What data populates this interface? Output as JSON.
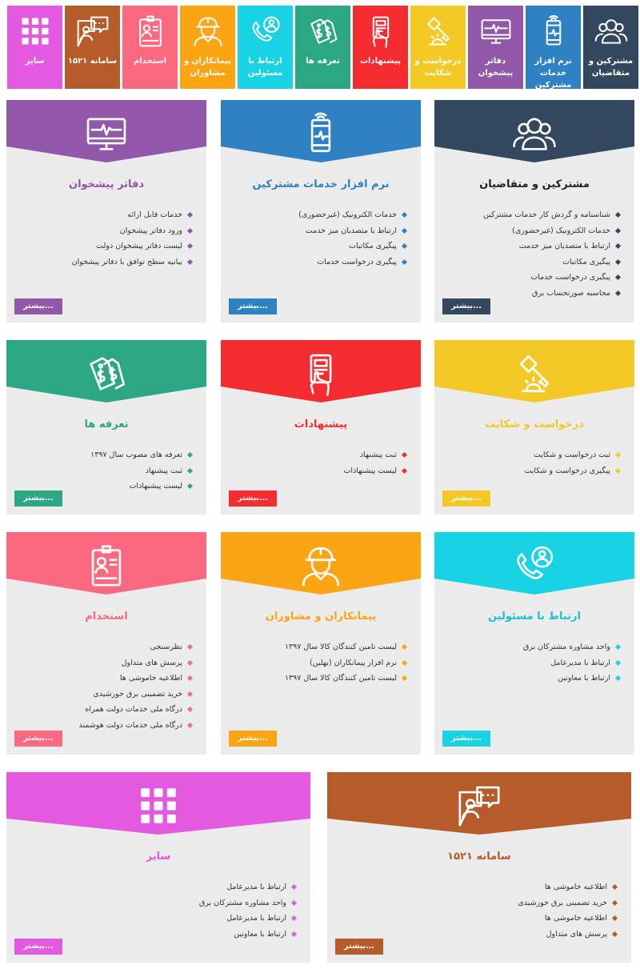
{
  "colors": {
    "navy": "#33485f",
    "blue": "#2e81c3",
    "purple": "#9157a8",
    "yellow": "#f4c825",
    "red": "#f42c2f",
    "green": "#2ba784",
    "cyan": "#18d3e3",
    "orange": "#fba414",
    "pink": "#fb6980",
    "magenta": "#e359e0",
    "brown": "#b65c2b"
  },
  "topnav": [
    {
      "label": "مشترکین و متقاضیان",
      "icon": "users-icon",
      "color": "#33485f"
    },
    {
      "label": "نرم افزار خدمات مشترکین",
      "icon": "mobile-pulse-icon",
      "color": "#2e81c3"
    },
    {
      "label": "دفاتر پیشخوان",
      "icon": "monitor-pulse-icon",
      "color": "#9157a8"
    },
    {
      "label": "درخواست و شکایت",
      "icon": "gavel-icon",
      "color": "#f4c825"
    },
    {
      "label": "پیشنهادات",
      "icon": "hand-phone-icon",
      "color": "#f42c2f"
    },
    {
      "label": "تعرفه ها",
      "icon": "price-tag-icon",
      "color": "#2ba784"
    },
    {
      "label": "ارتباط با مسئولین",
      "icon": "phone-user-icon",
      "color": "#18d3e3"
    },
    {
      "label": "پیمانکاران و مشاوران",
      "icon": "worker-icon",
      "color": "#fba414"
    },
    {
      "label": "استخدام",
      "icon": "id-card-icon",
      "color": "#fb6980"
    },
    {
      "label": "سامانه ۱۵۲۱",
      "icon": "chat-user-icon",
      "color": "#b65c2b"
    },
    {
      "label": "سایر",
      "icon": "grid-icon",
      "color": "#e359e0"
    }
  ],
  "more_label": "بیشتر...",
  "cards": [
    {
      "title": "مشترکین و متقاضیان",
      "icon": "users-icon",
      "color": "#33485f",
      "title_color": "#222222",
      "items": [
        "شناسنامه و گردش کار خدمات مشترکین",
        "خدمات الکترونیک (غیرحضوری)",
        "ارتباط با متصدیان میز خدمت",
        "پیگیری مکاتبات",
        "پیگیری درخواست خدمات",
        "محاسبه صورتحساب برق"
      ]
    },
    {
      "title": "نرم افزار خدمات مشترکین",
      "icon": "mobile-pulse-icon",
      "color": "#2e81c3",
      "title_color": "#2e81c3",
      "items": [
        "خدمات الکترونیک (غیرحضوری)",
        "ارتباط با متصدیان میز خدمت",
        "پیگیری مکاتبات",
        "پیگیری درخواست خدمات"
      ]
    },
    {
      "title": "دفاتر پیشخوان",
      "icon": "monitor-pulse-icon",
      "color": "#9157a8",
      "title_color": "#9157a8",
      "items": [
        "خدمات قابل ارائه",
        "ورود دفاتر پیشخوان",
        "لیست دفاتر پیشخوان دولت",
        "بیانیه سطح توافق با دفاتر پیشخوان"
      ]
    },
    {
      "title": "درخواست و شکایت",
      "icon": "gavel-icon",
      "color": "#f4c825",
      "title_color": "#f4c825",
      "items": [
        "ثبت درخواست و شکایت",
        "پیگیری درخواست و شکایت"
      ]
    },
    {
      "title": "پیشنهادات",
      "icon": "hand-phone-icon",
      "color": "#f42c2f",
      "title_color": "#f42c2f",
      "items": [
        "ثبت پیشنهاد",
        "لیست پیشنهادات"
      ]
    },
    {
      "title": "تعرفه ها",
      "icon": "price-tag-icon",
      "color": "#2ba784",
      "title_color": "#2ba784",
      "items": [
        "تعرفه های مصوب سال ۱۳۹۷",
        "ثبت پیشنهاد",
        "لیست پیشنهادات"
      ]
    },
    {
      "title": "ارتباط با مسئولین",
      "icon": "phone-user-icon",
      "color": "#18d3e3",
      "title_color": "#18c3d3",
      "items": [
        "واحد مشاوره مشترکان برق",
        "ارتباط با مدیرعامل",
        "ارتباط با معاونین"
      ]
    },
    {
      "title": "پیمانکاران و مشاوران",
      "icon": "worker-icon",
      "color": "#fba414",
      "title_color": "#fba414",
      "items": [
        "لیست تامین کنندگان کالا سال ۱۳۹۷",
        "نرم افزار پیمانکاران (بهلین)",
        "لیست تامین کنندگان کالا سال ۱۳۹۷"
      ]
    },
    {
      "title": "استخدام",
      "icon": "id-card-icon",
      "color": "#fb6980",
      "title_color": "#fb6980",
      "items": [
        "نظرسنجی",
        "پرسش های متداول",
        "اطلاعیه خاموشی ها",
        "خرید تضمینی برق خورشیدی",
        "درگاه ملی خدمات دولت همراه",
        "درگاه ملی خدمات دولت هوشمند"
      ]
    },
    {
      "title": "سامانه ۱۵۲۱",
      "icon": "chat-user-icon",
      "color": "#b65c2b",
      "title_color": "#b65c2b",
      "items": [
        "اطلاعیه خاموشی ها",
        "خرید تضمینی برق خورشیدی",
        "اطلاعیه خاموشی ها",
        "پرسش های متداول"
      ]
    },
    {
      "title": "سایر",
      "icon": "grid-icon",
      "color": "#e359e0",
      "title_color": "#e359e0",
      "items": [
        "ارتباط با مدیرعامل",
        "واحد مشاوره مشترکان برق",
        "ارتباط با مدیرعامل",
        "ارتباط با معاونین"
      ]
    }
  ]
}
